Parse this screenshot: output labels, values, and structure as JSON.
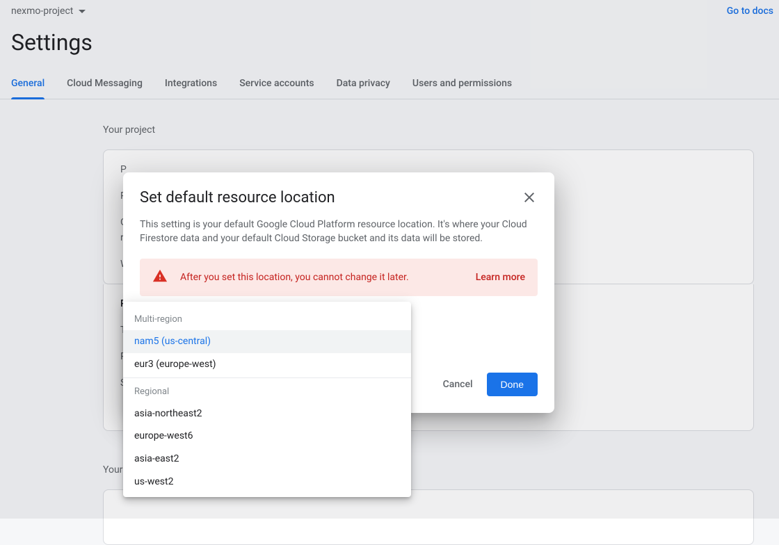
{
  "header": {
    "project_name": "nexmo-project",
    "docs_link": "Go to docs"
  },
  "page_title": "Settings",
  "tabs": [
    {
      "label": "General",
      "active": true
    },
    {
      "label": "Cloud Messaging",
      "active": false
    },
    {
      "label": "Integrations",
      "active": false
    },
    {
      "label": "Service accounts",
      "active": false
    },
    {
      "label": "Data privacy",
      "active": false
    },
    {
      "label": "Users and permissions",
      "active": false
    }
  ],
  "sections": {
    "your_project": "Your project",
    "your_apps": "Your ",
    "card1_rows": [
      "P",
      "P",
      "G",
      "r",
      "W"
    ],
    "card2_rows": [
      "P",
      "T",
      "P",
      "S"
    ]
  },
  "dialog": {
    "title": "Set default resource location",
    "description": "This setting is your default Google Cloud Platform resource location. It's where your Cloud Firestore data and your default Cloud Storage bucket and its data will be stored.",
    "alert_text": "After you set this location, you cannot change it later.",
    "learn_more": "Learn more",
    "cancel": "Cancel",
    "done": "Done"
  },
  "dropdown": {
    "group1_label": "Multi-region",
    "group1_options": [
      {
        "label": "nam5 (us-central)",
        "selected": true
      },
      {
        "label": "eur3 (europe-west)",
        "selected": false
      }
    ],
    "group2_label": "Regional",
    "group2_options": [
      {
        "label": "asia-northeast2"
      },
      {
        "label": "europe-west6"
      },
      {
        "label": "asia-east2"
      },
      {
        "label": "us-west2"
      }
    ]
  }
}
